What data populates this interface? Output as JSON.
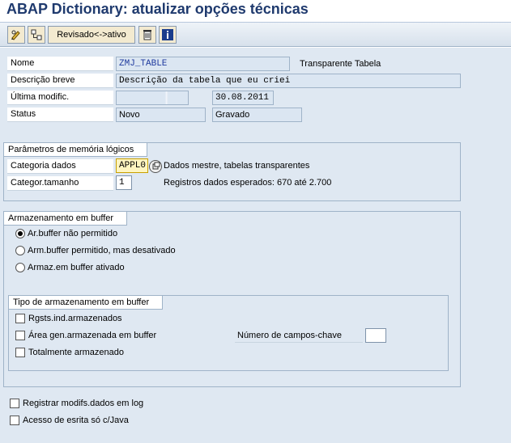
{
  "window": {
    "title": "ABAP Dictionary: atualizar opções técnicas"
  },
  "toolbar": {
    "toggle_label": "Revisado<->ativo"
  },
  "header": {
    "name_label": "Nome",
    "name_value": "ZMJ_TABLE",
    "table_type": "Transparente Tabela",
    "desc_label": "Descrição breve",
    "desc_value": "Descrição da tabela que eu criei",
    "lastmod_label": "Última modific.",
    "lastmod_user": "",
    "lastmod_date": "30.08.2011",
    "status_label": "Status",
    "status_value": "Novo",
    "status_value2": "Gravado"
  },
  "memory": {
    "title": "Parâmetros de memória lógicos",
    "category_label": "Categoria dados",
    "category_value": "APPL0",
    "category_desc": "Dados mestre, tabelas transparentes",
    "size_label": "Categor.tamanho",
    "size_value": "1",
    "size_desc": "Registros dados esperados: 670 até 2.700"
  },
  "buffer": {
    "title": "Armazenamento em buffer",
    "options": [
      "Ar.buffer não permitido",
      "Arm.buffer permitido, mas desativado",
      "Armaz.em buffer ativado"
    ],
    "selected_index": 0
  },
  "buffer_type": {
    "title": "Tipo de armazenamento em buffer",
    "options": [
      "Rgsts.ind.armazenados",
      "Área gen.armazenada em buffer",
      "Totalmente armazenado"
    ],
    "key_fields_label": "Número de campos-chave",
    "key_fields_value": ""
  },
  "bottom": {
    "log_label": "Registrar modifs.dados em log",
    "java_label": "Acesso de esrita só c/Java"
  },
  "colors": {
    "title": "#1f3a6e",
    "workarea": "#dfe8f2",
    "field": "#dbe6f2",
    "highlight": "#fff5c0"
  }
}
